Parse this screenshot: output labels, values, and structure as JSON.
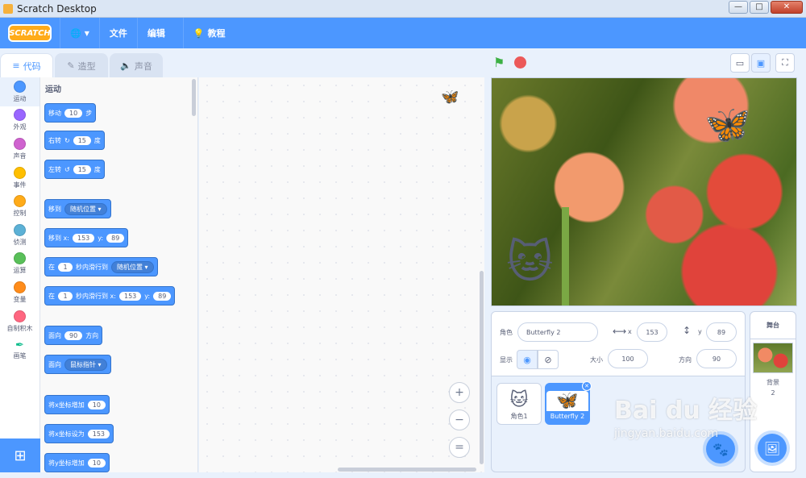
{
  "window": {
    "title": "Scratch Desktop",
    "minimize": "—",
    "maximize": "□",
    "close": "✕"
  },
  "menubar": {
    "logo": "SCRATCH",
    "items": [
      "文件",
      "编辑"
    ],
    "tutorial": "教程"
  },
  "tabs": [
    {
      "label": "代码",
      "icon": "code-icon"
    },
    {
      "label": "造型",
      "icon": "brush-icon"
    },
    {
      "label": "声音",
      "icon": "speaker-icon"
    }
  ],
  "categories": [
    {
      "label": "运动",
      "color": "#4c97ff"
    },
    {
      "label": "外观",
      "color": "#9966ff"
    },
    {
      "label": "声音",
      "color": "#cf63cf"
    },
    {
      "label": "事件",
      "color": "#ffbf00"
    },
    {
      "label": "控制",
      "color": "#ffab19"
    },
    {
      "label": "侦测",
      "color": "#5cb1d6"
    },
    {
      "label": "运算",
      "color": "#59c059"
    },
    {
      "label": "变量",
      "color": "#ff8c1a"
    },
    {
      "label": "自制积木",
      "color": "#ff6680"
    },
    {
      "label": "画笔",
      "color": "#0fbd8c"
    }
  ],
  "palette": {
    "title": "运动",
    "blocks": {
      "move": {
        "a": "移动",
        "n": "10",
        "b": "步"
      },
      "turn_right": {
        "a": "右转",
        "n": "15",
        "b": "度"
      },
      "turn_left": {
        "a": "左转",
        "n": "15",
        "b": "度"
      },
      "goto": {
        "a": "移到",
        "d": "随机位置"
      },
      "goto_xy": {
        "a": "移到 x:",
        "x": "153",
        "b": "y:",
        "y": "89"
      },
      "glide": {
        "a": "在",
        "n": "1",
        "b": "秒内滑行到",
        "d": "随机位置"
      },
      "glide_xy": {
        "a": "在",
        "n": "1",
        "b": "秒内滑行到 x:",
        "x": "153",
        "c": "y:",
        "y": "89"
      },
      "point_dir": {
        "a": "面向",
        "n": "90",
        "b": "方向"
      },
      "point_towards": {
        "a": "面向",
        "d": "鼠标指针"
      },
      "change_x": {
        "a": "将x坐标增加",
        "n": "10"
      },
      "set_x": {
        "a": "将x坐标设为",
        "n": "153"
      },
      "change_y": {
        "a": "将y坐标增加",
        "n": "10"
      }
    }
  },
  "workspace": {
    "zoom_in": "+",
    "zoom_out": "−",
    "zoom_reset": "="
  },
  "sprite_info": {
    "sprite_label": "角色",
    "sprite_name": "Butterfly 2",
    "x_label": "x",
    "x": "153",
    "y_label": "y",
    "y": "89",
    "show_label": "显示",
    "size_label": "大小",
    "size": "100",
    "direction_label": "方向",
    "direction": "90"
  },
  "sprites": [
    {
      "name": "角色1",
      "thumb": "🐱"
    },
    {
      "name": "Butterfly 2",
      "thumb": "🦋"
    }
  ],
  "stage_pane": {
    "header": "舞台",
    "backdrop_label": "背景",
    "backdrop_count": "2"
  },
  "watermark": {
    "logo": "Bai du 经验",
    "url": "jingyan.baidu.com"
  }
}
